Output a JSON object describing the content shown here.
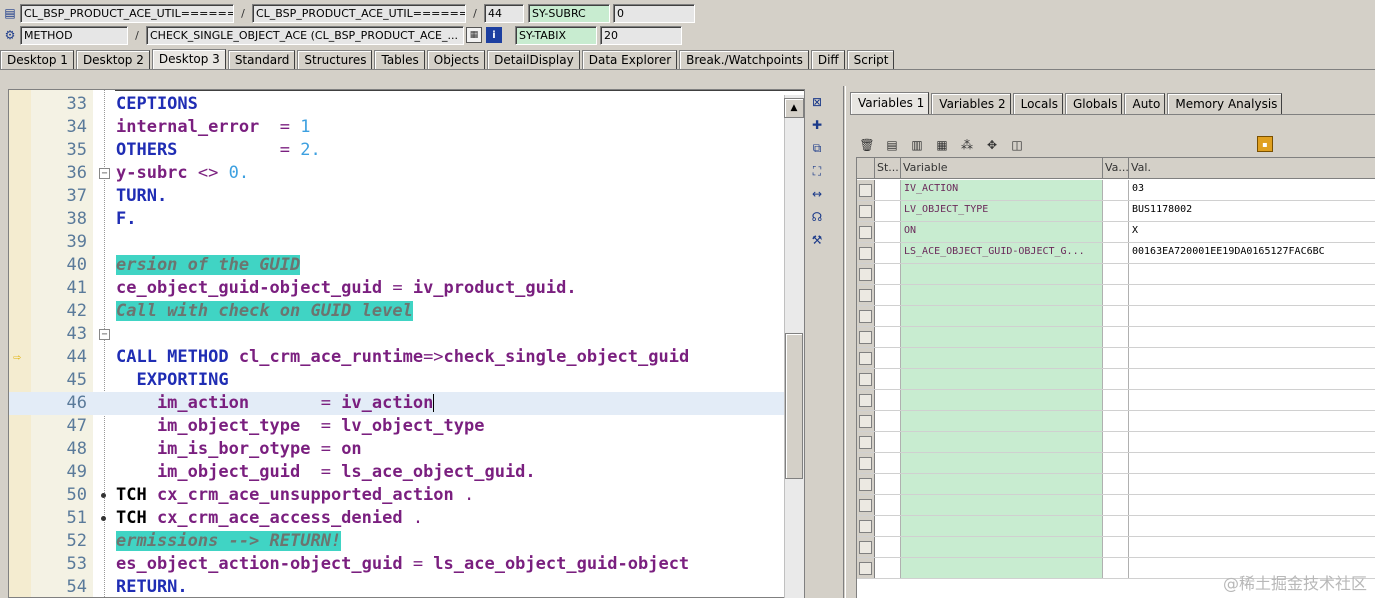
{
  "header": {
    "row1": {
      "field1": "CL_BSP_PRODUCT_ACE_UTIL======",
      "sep1": "/",
      "field2": "CL_BSP_PRODUCT_ACE_UTIL======",
      "sep2": "/",
      "line_no": "44",
      "sysvar_name": "SY-SUBRC",
      "sysvar_value": "0"
    },
    "row2": {
      "type": "METHOD",
      "sep1": "/",
      "method": "CHECK_SINGLE_OBJECT_ACE (CL_BSP_PRODUCT_ACE_...",
      "sysvar_name": "SY-TABIX",
      "sysvar_value": "20"
    }
  },
  "tabs": [
    "Desktop 1",
    "Desktop 2",
    "Desktop 3",
    "Standard",
    "Structures",
    "Tables",
    "Objects",
    "DetailDisplay",
    "Data Explorer",
    "Break./Watchpoints",
    "Diff",
    "Script"
  ],
  "active_tab": "Desktop 3",
  "editor": {
    "lines": [
      {
        "n": "33",
        "fold": "",
        "segs": [
          {
            "c": "kw",
            "t": "CEPTIONS"
          }
        ]
      },
      {
        "n": "34",
        "fold": "",
        "segs": [
          {
            "c": "tx",
            "t": "internal_error"
          },
          {
            "c": "op",
            "t": "  = "
          },
          {
            "c": "nm",
            "t": "1"
          }
        ]
      },
      {
        "n": "35",
        "fold": "",
        "segs": [
          {
            "c": "kw",
            "t": "OTHERS"
          },
          {
            "c": "op",
            "t": "          = "
          },
          {
            "c": "nm",
            "t": "2."
          }
        ]
      },
      {
        "n": "36",
        "fold": "box",
        "segs": [
          {
            "c": "tx",
            "t": "y-subrc"
          },
          {
            "c": "op",
            "t": " <> "
          },
          {
            "c": "nm",
            "t": "0."
          }
        ]
      },
      {
        "n": "37",
        "fold": "",
        "segs": [
          {
            "c": "kw",
            "t": "TURN."
          }
        ]
      },
      {
        "n": "38",
        "fold": "",
        "segs": [
          {
            "c": "kw",
            "t": "F."
          }
        ]
      },
      {
        "n": "39",
        "fold": "",
        "segs": []
      },
      {
        "n": "40",
        "fold": "",
        "segs": [
          {
            "c": "cm",
            "t": "ersion of the GUID"
          }
        ]
      },
      {
        "n": "41",
        "fold": "",
        "segs": [
          {
            "c": "tx",
            "t": "ce_object_guid-object_guid"
          },
          {
            "c": "op",
            "t": " = "
          },
          {
            "c": "tx",
            "t": "iv_product_guid."
          }
        ]
      },
      {
        "n": "42",
        "fold": "",
        "segs": [
          {
            "c": "cm",
            "t": "Call with check on GUID level"
          }
        ]
      },
      {
        "n": "43",
        "fold": "box",
        "segs": []
      },
      {
        "n": "44",
        "fold": "",
        "arrow": true,
        "segs": [
          {
            "c": "kw",
            "t": "CALL METHOD "
          },
          {
            "c": "tx",
            "t": "cl_crm_ace_runtime"
          },
          {
            "c": "op",
            "t": "=>"
          },
          {
            "c": "tx",
            "t": "check_single_object_guid"
          }
        ]
      },
      {
        "n": "45",
        "fold": "",
        "segs": [
          {
            "c": "kw",
            "t": "  EXPORTING"
          }
        ]
      },
      {
        "n": "46",
        "fold": "",
        "cursor": true,
        "segs": [
          {
            "c": "tx",
            "t": "    im_action"
          },
          {
            "c": "op",
            "t": "       = "
          },
          {
            "c": "tx",
            "t": "iv_action"
          }
        ]
      },
      {
        "n": "47",
        "fold": "",
        "segs": [
          {
            "c": "tx",
            "t": "    im_object_type"
          },
          {
            "c": "op",
            "t": "  = "
          },
          {
            "c": "tx",
            "t": "lv_object_type"
          }
        ]
      },
      {
        "n": "48",
        "fold": "",
        "segs": [
          {
            "c": "tx",
            "t": "    im_is_bor_otype"
          },
          {
            "c": "op",
            "t": " = "
          },
          {
            "c": "tx",
            "t": "on"
          }
        ]
      },
      {
        "n": "49",
        "fold": "",
        "segs": [
          {
            "c": "tx",
            "t": "    im_object_guid"
          },
          {
            "c": "op",
            "t": "  = "
          },
          {
            "c": "tx",
            "t": "ls_ace_object_guid."
          }
        ]
      },
      {
        "n": "50",
        "fold": "dot",
        "segs": [
          {
            "c": "plain",
            "t": "TCH "
          },
          {
            "c": "tx",
            "t": "cx_crm_ace_unsupported_action"
          },
          {
            "c": "op",
            "t": " ."
          }
        ]
      },
      {
        "n": "51",
        "fold": "dot",
        "segs": [
          {
            "c": "plain",
            "t": "TCH "
          },
          {
            "c": "tx",
            "t": "cx_crm_ace_access_denied"
          },
          {
            "c": "op",
            "t": " ."
          }
        ]
      },
      {
        "n": "52",
        "fold": "",
        "segs": [
          {
            "c": "cm",
            "t": "ermissions --> RETURN!"
          }
        ]
      },
      {
        "n": "53",
        "fold": "",
        "segs": [
          {
            "c": "tx",
            "t": "es_object_action-object_guid"
          },
          {
            "c": "op",
            "t": " = "
          },
          {
            "c": "tx",
            "t": "ls_ace_object_guid-object"
          }
        ]
      },
      {
        "n": "54",
        "fold": "",
        "segs": [
          {
            "c": "kw",
            "t": "RETURN."
          }
        ]
      }
    ]
  },
  "right_tabs": [
    "Variables 1",
    "Variables 2",
    "Locals",
    "Globals",
    "Auto",
    "Memory Analysis"
  ],
  "active_right_tab": "Variables 1",
  "grid": {
    "headers": {
      "st": "St...",
      "variable": "Variable",
      "va": "Va...",
      "val": "Val."
    },
    "rows": [
      {
        "variable": "IV_ACTION",
        "val": "03"
      },
      {
        "variable": "LV_OBJECT_TYPE",
        "val": "BUS1178002"
      },
      {
        "variable": "ON",
        "val": "X"
      },
      {
        "variable": "LS_ACE_OBJECT_GUID-OBJECT_G...",
        "val": "00163EA720001EE19DA0165127FAC6BC"
      }
    ],
    "empty_rows": 15
  },
  "watermark": "@稀土掘金技术社区"
}
